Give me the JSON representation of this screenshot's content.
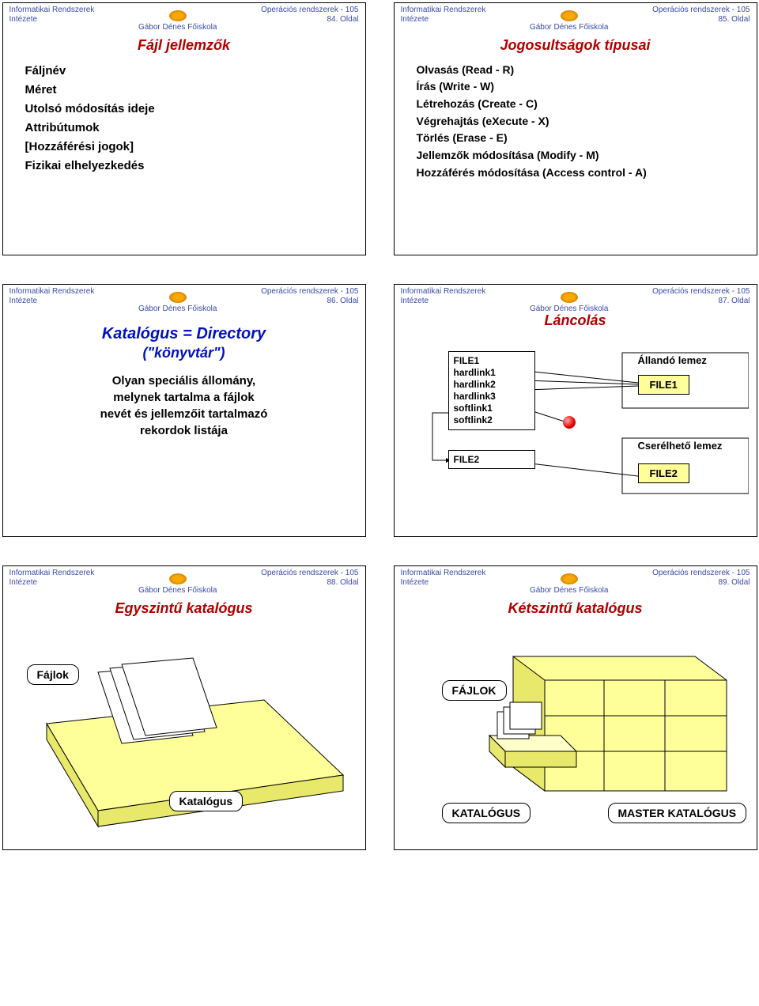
{
  "common": {
    "org_line1": "Informatikai Rendszerek",
    "org_line2": "Intézete",
    "school": "Gábor Dénes Főiskola",
    "course": "Operációs rendszerek - 105"
  },
  "slides": {
    "s84": {
      "page": "84. Oldal",
      "title": "Fájl jellemzők",
      "items": [
        "Fáljnév",
        "Méret",
        "Utolsó módosítás ideje",
        "Attribútumok",
        "[Hozzáférési jogok]",
        "Fizikai elhelyezkedés"
      ]
    },
    "s85": {
      "page": "85. Oldal",
      "title": "Jogosultságok típusai",
      "items": [
        "Olvasás (Read - R)",
        "Írás (Write - W)",
        "Létrehozás (Create - C)",
        "Végrehajtás (eXecute - X)",
        "Törlés (Erase - E)",
        "Jellemzők módosítása (Modify - M)",
        "Hozzáférés módosítása (Access control - A)"
      ]
    },
    "s86": {
      "page": "86. Oldal",
      "title_main": "Katalógus = Directory",
      "title_sub": "(\"könyvtár\")",
      "desc_l1": "Olyan speciális állomány,",
      "desc_l2": "melynek tartalma a fájlok",
      "desc_l3": "nevét és jellemzőit tartalmazó",
      "desc_l4": "rekordok listája"
    },
    "s87": {
      "page": "87. Oldal",
      "title": "Láncolás",
      "left_box": {
        "l1": "FILE1",
        "l2": "hardlink1",
        "l3": "hardlink2",
        "l4": "hardlink3",
        "l5": "softlink1",
        "l6": "softlink2"
      },
      "left_box2": "FILE2",
      "right_label1": "Állandó lemez",
      "right_file1": "FILE1",
      "right_label2": "Cserélhető lemez",
      "right_file2": "FILE2"
    },
    "s88": {
      "page": "88. Oldal",
      "title": "Egyszintű katalógus",
      "label_files": "Fájlok",
      "label_catalog": "Katalógus"
    },
    "s89": {
      "page": "89. Oldal",
      "title": "Kétszintű katalógus",
      "label_files": "FÁJLOK",
      "label_catalog": "KATALÓGUS",
      "label_master": "MASTER KATALÓGUS"
    }
  }
}
